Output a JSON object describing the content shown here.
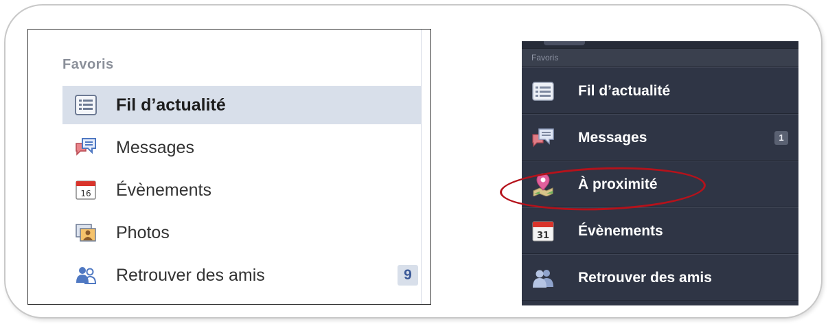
{
  "left": {
    "header": "Favoris",
    "items": [
      {
        "label": "Fil d’actualité",
        "icon": "news-feed-icon"
      },
      {
        "label": "Messages",
        "icon": "messages-icon"
      },
      {
        "label": "Évènements",
        "icon": "calendar-icon",
        "icon_text": "16"
      },
      {
        "label": "Photos",
        "icon": "photos-icon"
      },
      {
        "label": "Retrouver des amis",
        "icon": "find-friends-icon",
        "count": "9"
      }
    ]
  },
  "right": {
    "header": "Favoris",
    "items": [
      {
        "label": "Fil d’actualité",
        "icon": "news-feed-icon"
      },
      {
        "label": "Messages",
        "icon": "messages-icon",
        "count": "1"
      },
      {
        "label": "À proximité",
        "icon": "nearby-map-pin-icon"
      },
      {
        "label": "Évènements",
        "icon": "calendar-icon",
        "icon_text": "31"
      },
      {
        "label": "Retrouver des amis",
        "icon": "find-friends-icon"
      }
    ]
  },
  "colors": {
    "selected_bg": "#d8dfea",
    "dark_panel": "#2f3545",
    "highlight": "#b5121b"
  }
}
